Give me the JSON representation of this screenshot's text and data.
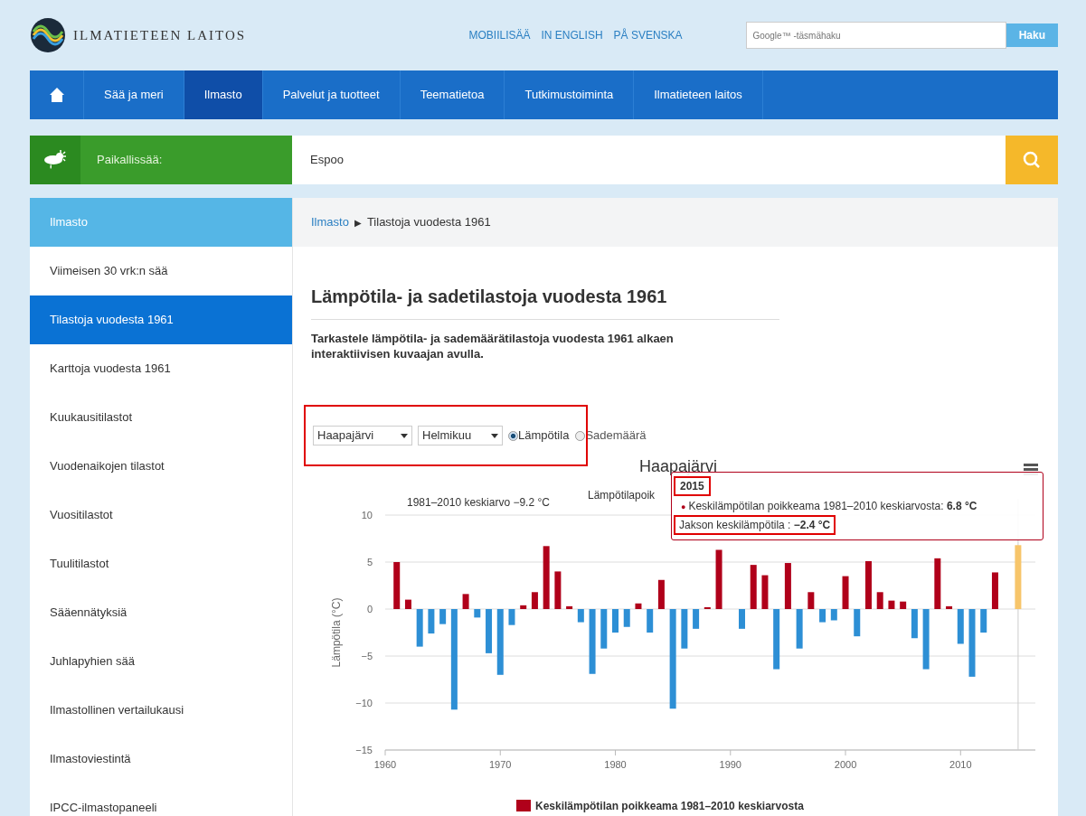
{
  "header": {
    "logo_text": "ILMATIETEEN LAITOS",
    "language_links": [
      "MOBIILISÄÄ",
      "IN ENGLISH",
      "PÅ SVENSKA"
    ],
    "search": {
      "placeholder": "Google™ -täsmähaku",
      "button": "Haku"
    }
  },
  "nav": [
    {
      "label": "Sää ja meri",
      "selected": false
    },
    {
      "label": "Ilmasto",
      "selected": true
    },
    {
      "label": "Palvelut ja tuotteet",
      "selected": false
    },
    {
      "label": "Teematietoa",
      "selected": false
    },
    {
      "label": "Tutkimustoiminta",
      "selected": false
    },
    {
      "label": "Ilmatieteen laitos",
      "selected": false
    }
  ],
  "local_weather": {
    "label": "Paikallissää:",
    "value": "Espoo"
  },
  "sidebar": {
    "heading": "Ilmasto",
    "items": [
      {
        "label": "Viimeisen 30 vrk:n sää",
        "selected": false
      },
      {
        "label": "Tilastoja vuodesta 1961",
        "selected": true
      },
      {
        "label": "Karttoja vuodesta 1961",
        "selected": false
      },
      {
        "label": "Kuukausitilastot",
        "selected": false
      },
      {
        "label": "Vuodenaikojen tilastot",
        "selected": false
      },
      {
        "label": "Vuositilastot",
        "selected": false
      },
      {
        "label": "Tuulitilastot",
        "selected": false
      },
      {
        "label": "Sääennätyksiä",
        "selected": false
      },
      {
        "label": "Juhlapyhien sää",
        "selected": false
      },
      {
        "label": "Ilmastollinen vertailukausi",
        "selected": false
      },
      {
        "label": "Ilmastoviestintä",
        "selected": false
      },
      {
        "label": "IPCC-ilmastopaneeli",
        "selected": false
      }
    ]
  },
  "breadcrumb": {
    "link": "Ilmasto",
    "separator": "▶",
    "current": "Tilastoja vuodesta 1961"
  },
  "page_title": "Lämpötila- ja sadetilastoja vuodesta 1961",
  "intro": "Tarkastele lämpötila- ja sademäärätilastoja vuodesta 1961 alkaen interaktiivisen kuvaajan avulla.",
  "controls": {
    "framed": true,
    "station": "Haapajärvi",
    "month": "Helmikuu",
    "radios": [
      {
        "label": "Lämpötila",
        "selected": true
      },
      {
        "label": "Sademäärä",
        "selected": false
      }
    ]
  },
  "chart": {
    "subtitle": "Lämpötilapoik",
    "average_label": "1981–2010 keskiarvo −9.2 °C",
    "tooltip": {
      "title": "2015",
      "title_framed": true,
      "marker": "●",
      "series_label": "Keskilämpötilan poikkeama 1981–2010 keskiarvosta: ",
      "value": "6.8 °C",
      "period_label": "Jakson keskilämpötila : ",
      "period_value": "−2.4 °C",
      "period_framed": true
    },
    "chart_data": {
      "type": "bar",
      "title": "Haapajärvi",
      "ylabel": "Lämpötila (°C)",
      "x": [
        1961,
        1962,
        1963,
        1964,
        1965,
        1966,
        1967,
        1968,
        1969,
        1970,
        1971,
        1972,
        1973,
        1974,
        1975,
        1976,
        1977,
        1978,
        1979,
        1980,
        1981,
        1982,
        1983,
        1984,
        1985,
        1986,
        1987,
        1988,
        1989,
        1990,
        1991,
        1992,
        1993,
        1994,
        1995,
        1996,
        1997,
        1998,
        1999,
        2000,
        2001,
        2002,
        2003,
        2004,
        2005,
        2006,
        2007,
        2008,
        2009,
        2010,
        2011,
        2012,
        2013,
        2014,
        2015
      ],
      "series": [
        {
          "name": "Keskilämpötilan poikkeama 1981–2010 keskiarvosta",
          "color": "#b0001a",
          "values": [
            5.0,
            1.0,
            null,
            null,
            null,
            null,
            1.6,
            null,
            null,
            null,
            null,
            0.4,
            1.8,
            6.7,
            4.0,
            0.3,
            null,
            null,
            null,
            null,
            null,
            0.6,
            null,
            3.1,
            null,
            null,
            null,
            0.2,
            6.3,
            null,
            null,
            4.7,
            3.6,
            null,
            4.9,
            null,
            1.8,
            null,
            null,
            3.5,
            null,
            5.1,
            1.8,
            0.9,
            0.8,
            null,
            null,
            5.4,
            0.3,
            null,
            null,
            null,
            3.9,
            null,
            null
          ]
        },
        {
          "color": "#2d8fd5",
          "values": [
            null,
            null,
            -4.0,
            -2.6,
            -1.6,
            -10.7,
            null,
            -0.9,
            -4.7,
            -7.0,
            -1.7,
            null,
            null,
            null,
            null,
            null,
            -1.4,
            -6.9,
            -4.2,
            -2.5,
            -1.9,
            null,
            -2.5,
            null,
            -10.6,
            -4.2,
            -2.1,
            null,
            null,
            null,
            -2.1,
            null,
            null,
            -6.4,
            null,
            -4.2,
            null,
            -1.4,
            -1.2,
            null,
            -2.9,
            null,
            null,
            null,
            null,
            -3.1,
            -6.4,
            null,
            null,
            -3.7,
            -7.2,
            -2.5,
            null,
            null,
            null
          ]
        },
        {
          "color": "#f7c56a",
          "values": [
            null,
            null,
            null,
            null,
            null,
            null,
            null,
            null,
            null,
            null,
            null,
            null,
            null,
            null,
            null,
            null,
            null,
            null,
            null,
            null,
            null,
            null,
            null,
            null,
            null,
            null,
            null,
            null,
            null,
            null,
            null,
            null,
            null,
            null,
            null,
            null,
            null,
            null,
            null,
            null,
            null,
            null,
            null,
            null,
            null,
            null,
            null,
            null,
            null,
            null,
            null,
            null,
            null,
            null,
            6.8
          ]
        }
      ],
      "stacked": true,
      "grid": true,
      "ref_lines": [
        {
          "axis": "x",
          "value": 2015,
          "color": "#cccccc"
        }
      ],
      "xlim": [
        1960,
        2016.5
      ],
      "ylim": [
        -15,
        10
      ],
      "xticks": [
        1960,
        1970,
        1980,
        1990,
        2000,
        2010
      ],
      "yticks": [
        -15,
        -10,
        -5,
        0,
        5,
        10
      ]
    }
  }
}
